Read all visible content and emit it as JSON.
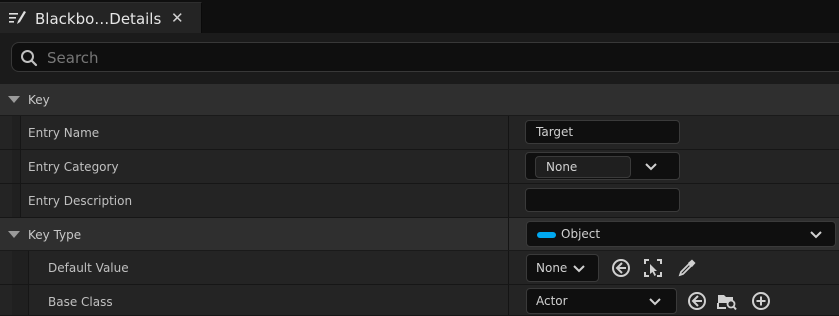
{
  "tab": {
    "title": "Blackbo…Details",
    "close_glyph": "✕",
    "icon": "edit-list-icon"
  },
  "search": {
    "placeholder": "Search",
    "value": "",
    "icon": "search-icon"
  },
  "categories": {
    "key": {
      "label": "Key"
    },
    "key_type": {
      "label": "Key Type"
    }
  },
  "properties": {
    "entry_name": {
      "label": "Entry Name",
      "value": "Target"
    },
    "entry_category": {
      "label": "Entry Category",
      "value": "None"
    },
    "entry_description": {
      "label": "Entry Description",
      "value": ""
    },
    "key_type": {
      "value": "Object",
      "pill_color": "#00a8f0"
    },
    "default_value": {
      "label": "Default Value",
      "value": "None"
    },
    "base_class": {
      "label": "Base Class",
      "value": "Actor"
    }
  },
  "icons": {
    "use_selected": "arrow-left-circle-icon",
    "browse": "browse-select-icon",
    "pick": "eyedropper-icon",
    "browse_asset": "folder-search-icon",
    "add": "plus-circle-icon"
  },
  "colors": {
    "accent_object": "#00a8f0",
    "panel_bg": "#1b1b1b",
    "category_bg": "#2f2f2f",
    "property_bg": "#242424"
  }
}
